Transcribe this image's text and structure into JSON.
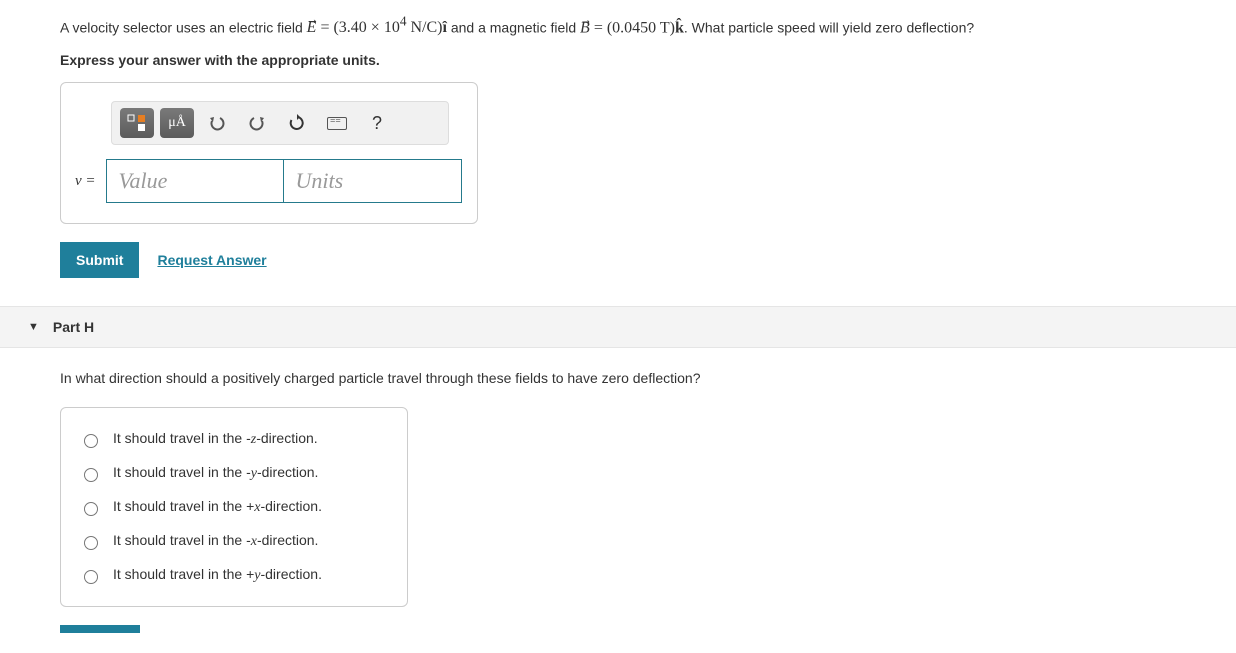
{
  "question": {
    "prefix": "A velocity selector uses an electric field ",
    "E_expr": "E⃗ = (3.40 × 10⁴ N/C) î",
    "mid": " and a magnetic field ",
    "B_expr": "B⃗ = (0.0450 T) k̂",
    "suffix": ". What particle speed will yield zero deflection?"
  },
  "instruction": "Express your answer with the appropriate units.",
  "toolbar": {
    "units_btn": "μÅ",
    "help": "?"
  },
  "input": {
    "label": "v =",
    "value_placeholder": "Value",
    "units_placeholder": "Units"
  },
  "buttons": {
    "submit": "Submit",
    "request": "Request Answer"
  },
  "partH": {
    "label": "Part H",
    "question": "In what direction should a positively charged particle travel through these fields to have zero deflection?",
    "options": [
      {
        "pre": "It should travel in the -",
        "var": "z",
        "post": "-direction."
      },
      {
        "pre": "It should travel in the -",
        "var": "y",
        "post": "-direction."
      },
      {
        "pre": "It should travel in the +",
        "var": "x",
        "post": "-direction."
      },
      {
        "pre": "It should travel in the -",
        "var": "x",
        "post": "-direction."
      },
      {
        "pre": "It should travel in the +",
        "var": "y",
        "post": "-direction."
      }
    ]
  }
}
